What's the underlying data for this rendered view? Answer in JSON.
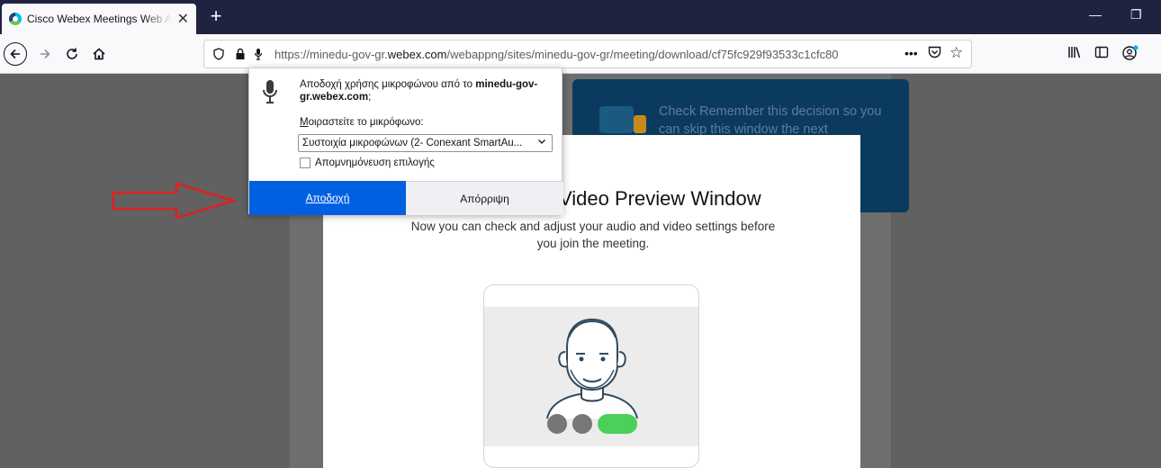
{
  "browser": {
    "tab_title": "Cisco Webex Meetings Web App",
    "tab_close": "✕",
    "new_tab": "+",
    "url_prefix": "https://minedu-gov-gr.",
    "url_domain": "webex.com",
    "url_suffix": "/webappng/sites/minedu-gov-gr/meeting/download/cf75fc929f93533c1cfc80",
    "window_minimize": "—",
    "window_restore": "❐"
  },
  "permission_popup": {
    "question_prefix": "Αποδοχή χρήσης μικροφώνου από το ",
    "question_host": "minedu-gov-gr.webex.com",
    "question_suffix": ";",
    "share_label": "Μοιραστείτε το μικρόφωνο:",
    "share_accesskey": "Μ",
    "share_label_rest": "οιραστείτε το μικρόφωνο:",
    "selected_device": "Συστοιχία μικροφώνων (2- Conexant SmartAu...",
    "remember_label": "Απομνημόνευση επιλογής",
    "accept_label": "Αποδοχή",
    "deny_label": "Απόρριψη"
  },
  "page": {
    "tip_text": "Check Remember this decision so you can skip this window the next",
    "card_title": "Video Preview Window",
    "card_subtitle": "Now you can check and adjust your audio and video settings before you join the meeting."
  },
  "colors": {
    "accept_blue": "#0061e0",
    "tip_bg": "#0b3a5f",
    "video_green": "#4cd05c",
    "annotation_arrow": "#e02020"
  }
}
